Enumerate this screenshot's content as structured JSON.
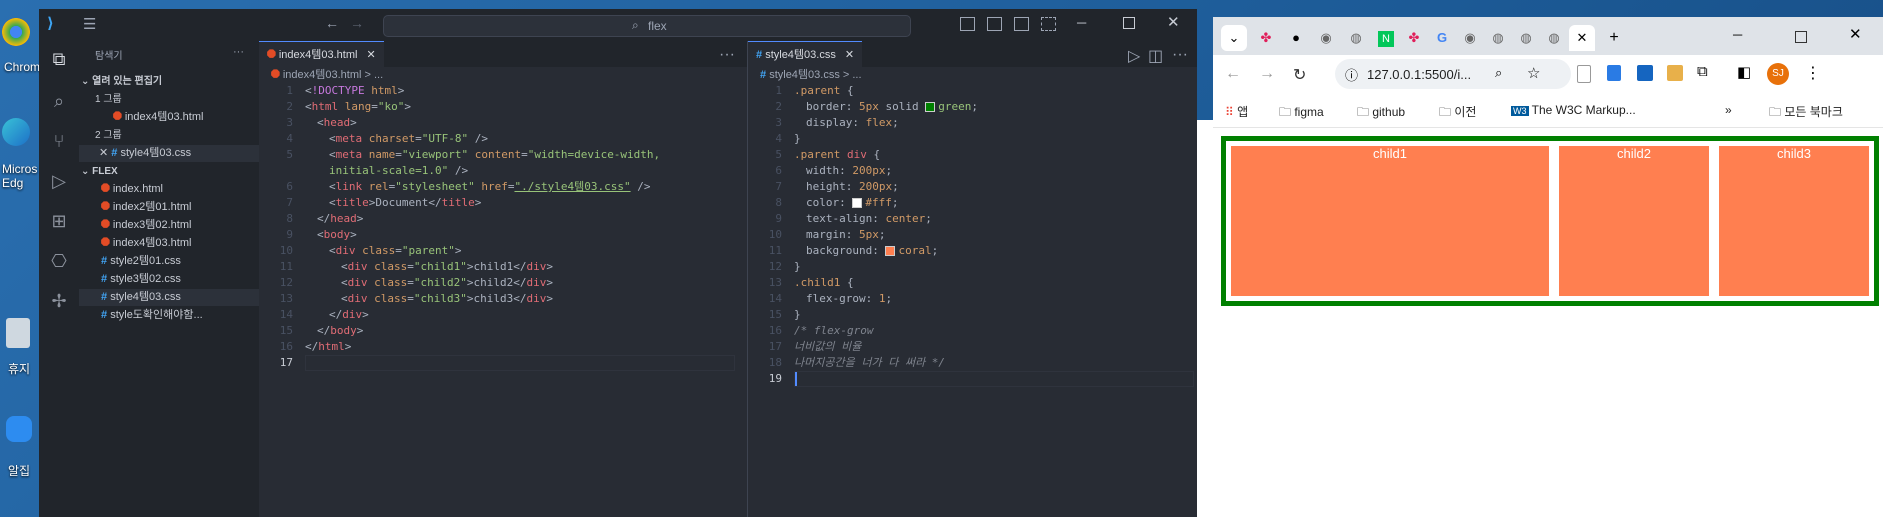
{
  "vscode": {
    "title_search": "flex",
    "sidebar": {
      "header": "탐색기",
      "open_editors_label": "열려 있는 편집기",
      "group1": "1 그룹",
      "group1_file": "index4템03.html",
      "group2": "2 그룹",
      "group2_file": "style4템03.css",
      "folder": "FLEX",
      "files": [
        "index.html",
        "index2템01.html",
        "index3템02.html",
        "index4템03.html",
        "style2템01.css",
        "style3템02.css",
        "style4템03.css",
        "style도확인해야함..."
      ]
    },
    "left_editor": {
      "tab": "index4템03.html",
      "breadcrumb": "index4템03.html > ...",
      "line_numbers": [
        "1",
        "2",
        "3",
        "4",
        "5",
        "",
        "6",
        "7",
        "8",
        "9",
        "10",
        "11",
        "12",
        "13",
        "14",
        "15",
        "16",
        "17"
      ]
    },
    "right_editor": {
      "tab": "style4템03.css",
      "breadcrumb": "style4템03.css > ...",
      "line_numbers": [
        "1",
        "2",
        "3",
        "4",
        "5",
        "6",
        "7",
        "8",
        "9",
        "10",
        "11",
        "12",
        "13",
        "14",
        "15",
        "16",
        "17",
        "18",
        "19"
      ]
    },
    "colors": {
      "green": "#008000",
      "coral": "#ff7f50",
      "white": "#ffffff"
    }
  },
  "chrome": {
    "url": "127.0.0.1:5500/i...",
    "profile_initials": "SJ",
    "bookmarks": [
      "앱",
      "figma",
      "github",
      "이전",
      "The W3C Markup...",
      "모든 북마크"
    ],
    "children": [
      "child1",
      "child2",
      "child3"
    ]
  },
  "desktop": {
    "icons": [
      "Chrom",
      "Micros Edg",
      "휴지",
      "알집"
    ]
  }
}
